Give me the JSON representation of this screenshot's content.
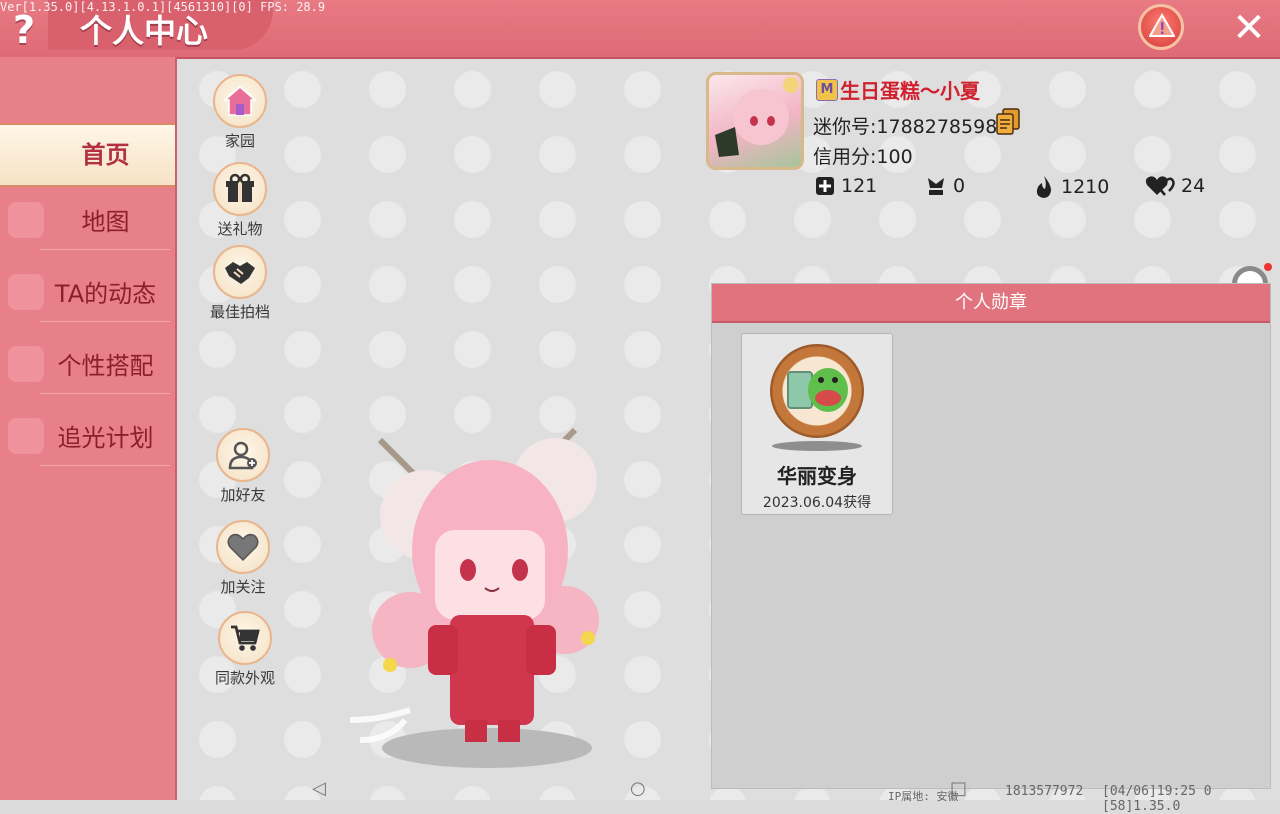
{
  "header": {
    "title": "个人中心",
    "debug": "Ver[1.35.0][4.13.1.0.1][4561310][0] FPS: 28.9",
    "help_symbol": "?",
    "close_symbol": "✕"
  },
  "sidebar": {
    "items": [
      {
        "label": "首页",
        "active": true
      },
      {
        "label": "地图",
        "active": false
      },
      {
        "label": "TA的动态",
        "active": false
      },
      {
        "label": "个性搭配",
        "active": false
      },
      {
        "label": "追光计划",
        "active": false
      }
    ]
  },
  "actions": {
    "home": "家园",
    "gift": "送礼物",
    "partner": "最佳拍档",
    "add_friend": "加好友",
    "follow": "加关注",
    "same_outfit": "同款外观"
  },
  "profile": {
    "vip_symbol": "M",
    "nickname": "生日蛋糕～小夏",
    "mini_id": "迷你号:1788278598",
    "credit": "信用分:100",
    "stats": {
      "plus": "121",
      "trophy": "0",
      "fire": "1210",
      "hearts": "24"
    }
  },
  "badges": {
    "header": "个人勋章",
    "items": [
      {
        "name": "华丽变身",
        "date": "2023.06.04获得"
      }
    ]
  },
  "footer": {
    "ip_location": "IP属地: 安徽",
    "uid": "1813577972",
    "time_version": "[04/06]19:25 0  [58]1.35.0"
  },
  "colors": {
    "theme": "#e0737d",
    "nickname": "#d0212f",
    "sidebar": "#e8808a"
  }
}
